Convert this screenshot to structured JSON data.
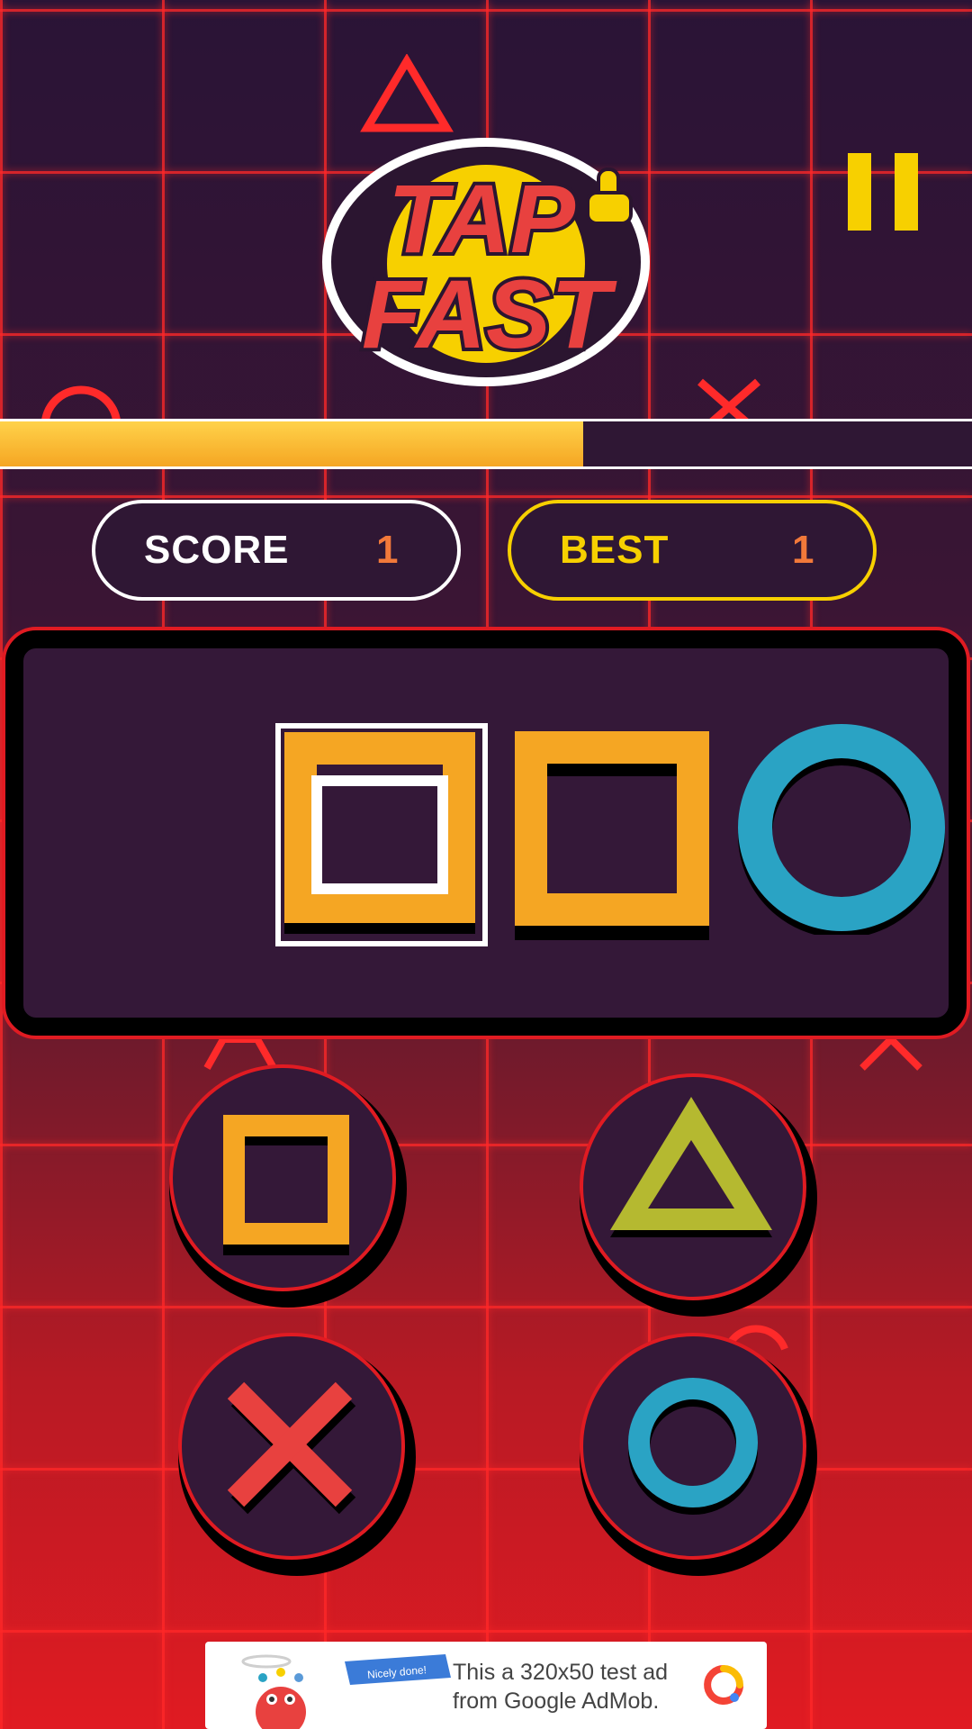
{
  "logo": {
    "line1": "TAP",
    "line2": "FAST"
  },
  "progress": {
    "fraction": 0.6
  },
  "score": {
    "label": "SCORE",
    "value": "1"
  },
  "best": {
    "label": "BEST",
    "value": "1"
  },
  "sequence": [
    "square",
    "square",
    "circle"
  ],
  "buttons": [
    "square",
    "triangle",
    "cross",
    "circle"
  ],
  "colors": {
    "square": "#f5a623",
    "triangle": "#b5b930",
    "cross": "#e8413f",
    "circle": "#2aa3c4",
    "pause": "#f7d000",
    "grid": "#ff2828"
  },
  "ad": {
    "badge": "Nicely done!",
    "text": "This a 320x50 test ad from Google AdMob."
  }
}
